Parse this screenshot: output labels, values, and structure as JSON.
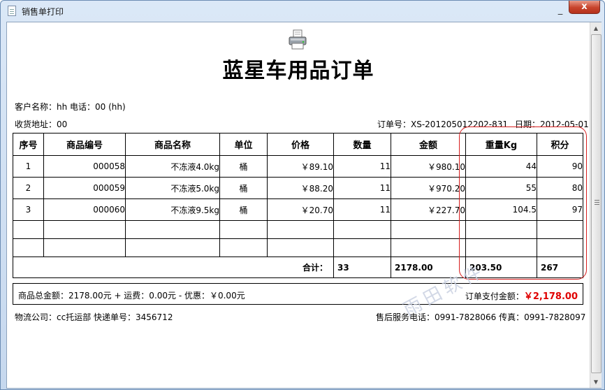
{
  "window": {
    "title": "销售单打印",
    "minimize_glyph": "_",
    "close_glyph": "x"
  },
  "document": {
    "title": "蓝星车用品订单",
    "customer_line": "客户名称：hh   电话：00 (hh)",
    "address_line": "收货地址：00",
    "order_no_label": "订单号：XS-201205012202-831",
    "date_label": "日期：2012-05-01"
  },
  "table": {
    "headers": [
      "序号",
      "商品编号",
      "商品名称",
      "单位",
      "价格",
      "数量",
      "金额",
      "重量Kg",
      "积分"
    ],
    "rows": [
      [
        "1",
        "000058",
        "不冻液4.0kg",
        "桶",
        "￥89.10",
        "11",
        "￥980.10",
        "44",
        "90"
      ],
      [
        "2",
        "000059",
        "不冻液5.0kg",
        "桶",
        "￥88.20",
        "11",
        "￥970.20",
        "55",
        "80"
      ],
      [
        "3",
        "000060",
        "不冻液9.5kg",
        "桶",
        "￥20.70",
        "11",
        "￥227.70",
        "104.5",
        "97"
      ]
    ],
    "total": {
      "label": "合计：",
      "quantity": "33",
      "amount": "2178.00",
      "weight": "203.50",
      "points": "267"
    }
  },
  "summary": {
    "left": "商品总金额：2178.00元 + 运费：0.00元 - 优惠：￥0.00元",
    "right_label": "订单支付金额：",
    "right_value": "￥2,178.00"
  },
  "footer": {
    "logistics": "物流公司：cc托运部   快递单号：3456712",
    "service": "售后服务电话：0991-7828066   传真：0991-7828097"
  },
  "watermark": "雨田软件",
  "colors": {
    "highlight": "#d81f1f",
    "pay": "#e00000"
  },
  "icons": {
    "printer": "printer-icon",
    "document": "document-icon"
  }
}
